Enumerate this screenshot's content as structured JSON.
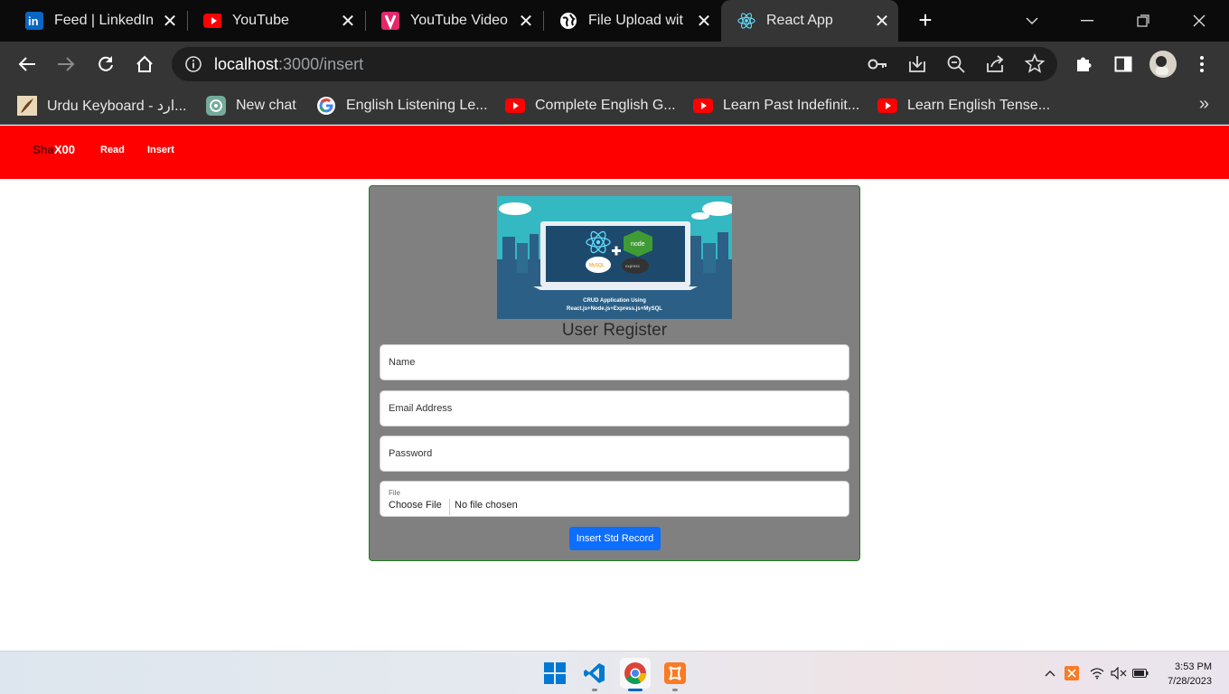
{
  "browser": {
    "tabs": [
      {
        "title": "Feed | LinkedIn",
        "icon": "linkedin-icon"
      },
      {
        "title": "YouTube",
        "icon": "youtube-icon"
      },
      {
        "title": "YouTube Video",
        "icon": "vidiq-icon"
      },
      {
        "title": "File Upload wit",
        "icon": "globe-icon"
      },
      {
        "title": "React App",
        "icon": "react-icon",
        "active": true
      }
    ],
    "url": {
      "host": "localhost",
      "path": ":3000/insert"
    },
    "bookmarks": [
      {
        "label": "Urdu Keyboard - ارد...",
        "icon": "quill-icon"
      },
      {
        "label": "New chat",
        "icon": "chatgpt-icon"
      },
      {
        "label": "English Listening Le...",
        "icon": "google-icon"
      },
      {
        "label": "Complete English G...",
        "icon": "youtube-icon"
      },
      {
        "label": "Learn Past Indefinit...",
        "icon": "youtube-icon"
      },
      {
        "label": "Learn English Tense...",
        "icon": "youtube-icon"
      }
    ],
    "more_bookmarks": "»"
  },
  "app": {
    "brand_part1": "Sha",
    "brand_part2": "X00",
    "nav": [
      "Read",
      "Insert"
    ],
    "form": {
      "title": "User Register",
      "name_placeholder": "Name",
      "email_placeholder": "Email Address",
      "password_placeholder": "Password",
      "file_label": "File",
      "choose_file": "Choose File",
      "no_file": "No file chosen",
      "submit": "Insert Std Record"
    },
    "hero_caption_1": "CRUD Application Using",
    "hero_caption_2": "React.js+Node.js+Express.js+MySQL"
  },
  "taskbar": {
    "time": "3:53 PM",
    "date": "7/28/2023"
  },
  "colors": {
    "navbar": "#ff0000",
    "card": "#808080",
    "submit": "#0d6efd"
  }
}
